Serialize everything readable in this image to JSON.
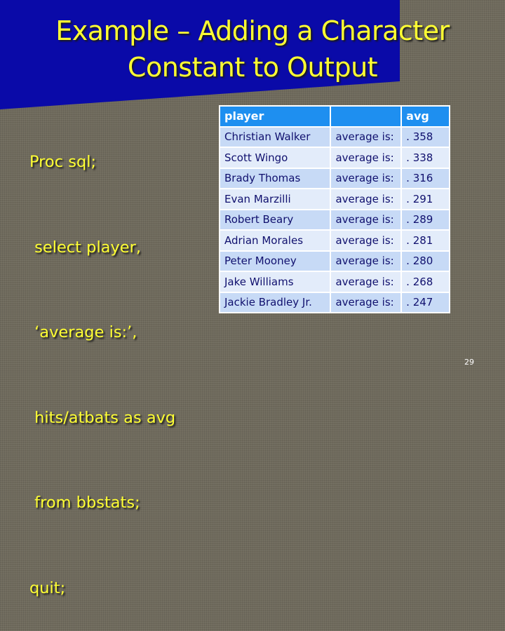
{
  "slide": {
    "title_lines": [
      "Example – Adding a Character",
      "Constant to Output"
    ],
    "code_lines": [
      "Proc sql;",
      " select player,",
      " ‘average is:’,",
      " hits/atbats as avg",
      " from bbstats;",
      "quit;"
    ],
    "page_number": "29",
    "colors": {
      "title": "#ffff33",
      "panel": "#0a0aa8",
      "background": "#6f6a5c",
      "header": "#1e8ff0",
      "row_odd": "#c7daf6",
      "row_even": "#e3ecfa",
      "cell_text": "#10106e"
    }
  },
  "table": {
    "headers": [
      "player",
      "",
      "avg"
    ],
    "rows": [
      [
        "Christian Walker",
        "average is:",
        ". 358"
      ],
      [
        "Scott Wingo",
        "average is:",
        ". 338"
      ],
      [
        "Brady Thomas",
        "average is:",
        ". 316"
      ],
      [
        "Evan Marzilli",
        "average is:",
        ". 291"
      ],
      [
        "Robert Beary",
        "average is:",
        ". 289"
      ],
      [
        "Adrian Morales",
        "average is:",
        ". 281"
      ],
      [
        "Peter Mooney",
        "average is:",
        ". 280"
      ],
      [
        "Jake Williams",
        "average is:",
        ". 268"
      ],
      [
        "Jackie Bradley Jr.",
        "average is:",
        ". 247"
      ]
    ]
  }
}
